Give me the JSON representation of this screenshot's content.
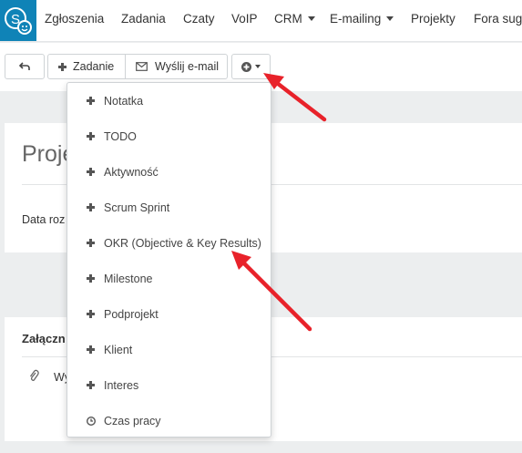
{
  "nav": {
    "items": [
      "Zgłoszenia",
      "Zadania",
      "Czaty",
      "VoIP",
      "CRM",
      "E-mailing",
      "Projekty",
      "Fora sug"
    ]
  },
  "toolbar": {
    "zadanie_label": "Zadanie",
    "email_label": "Wyślij e-mail"
  },
  "background": {
    "title_partial": "Proje",
    "data_partial": "Data roz",
    "attachments_partial": "Załączn",
    "attachment_row_partial": "Wy"
  },
  "dropdown": {
    "items": [
      {
        "label": "Notatka",
        "icon": "plus-icon"
      },
      {
        "label": "TODO",
        "icon": "plus-icon"
      },
      {
        "label": "Aktywność",
        "icon": "plus-icon"
      },
      {
        "label": "Scrum Sprint",
        "icon": "plus-icon"
      },
      {
        "label": "OKR (Objective & Key Results)",
        "icon": "plus-icon"
      },
      {
        "label": "Milestone",
        "icon": "plus-icon"
      },
      {
        "label": "Podprojekt",
        "icon": "plus-icon"
      },
      {
        "label": "Klient",
        "icon": "plus-icon"
      },
      {
        "label": "Interes",
        "icon": "plus-icon"
      },
      {
        "label": "Czas pracy",
        "icon": "clock-icon"
      }
    ]
  },
  "colors": {
    "brand": "#0f83b7",
    "annotation_arrow": "#e8222a"
  }
}
